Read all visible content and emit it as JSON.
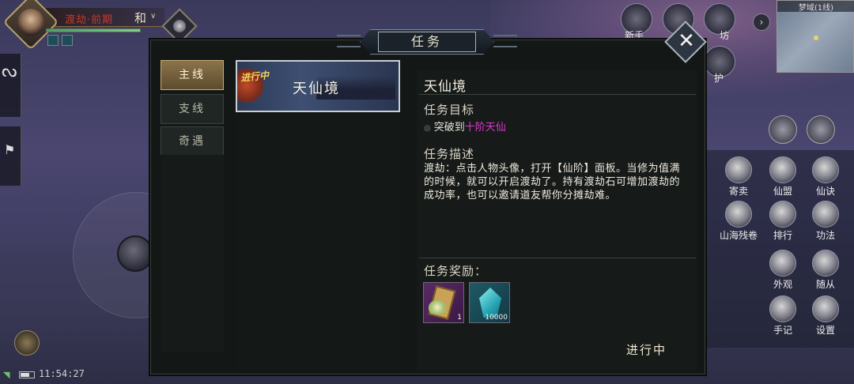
{
  "player": {
    "realm": "渡劫·前期",
    "extra": "和",
    "hp_fraction": 1.0
  },
  "top_right": {
    "icons": [
      {
        "label": "新手",
        "icon": "novice-icon"
      },
      {
        "label": "",
        "icon": "gift-icon"
      },
      {
        "label": "坊",
        "icon": "market-icon"
      },
      {
        "label": "护",
        "icon": "guard-icon"
      }
    ],
    "minimap_title": "梦域(1线)"
  },
  "window": {
    "title": "任务",
    "tabs": [
      "主线",
      "支线",
      "奇遇"
    ],
    "active_tab": 0
  },
  "quest_card": {
    "status_badge": "进行中",
    "title": "天仙境"
  },
  "detail": {
    "title": "天仙境",
    "objective_heading": "任务目标",
    "objective_prefix": "突破到",
    "objective_target": "十阶天仙",
    "description_heading": "任务描述",
    "description": "渡劫：点击人物头像，打开【仙阶】面板。当修为值满的时候，就可以开启渡劫了。持有渡劫石可增加渡劫的成功率，也可以邀请道友帮你分摊劫难。",
    "reward_heading": "任务奖励：",
    "rewards": [
      {
        "quantity": "1",
        "icon": "scroll-lotus-icon"
      },
      {
        "quantity": "10000",
        "icon": "crystal-icon"
      }
    ],
    "status": "进行中"
  },
  "right_menu": [
    {
      "label": "寄卖",
      "icon": "consign-icon"
    },
    {
      "label": "仙盟",
      "icon": "alliance-icon"
    },
    {
      "label": "仙诀",
      "icon": "skill-scroll-icon"
    },
    {
      "label": "山海残卷",
      "icon": "map-scroll-icon"
    },
    {
      "label": "排行",
      "icon": "ranking-icon"
    },
    {
      "label": "功法",
      "icon": "technique-icon"
    },
    {
      "label": "外观",
      "icon": "appearance-icon"
    },
    {
      "label": "随从",
      "icon": "follower-icon"
    },
    {
      "label": "手记",
      "icon": "notes-icon"
    },
    {
      "label": "设置",
      "icon": "settings-icon"
    }
  ],
  "status_bar": {
    "time": "11:54:27"
  },
  "colors": {
    "highlight": "#e03ad0",
    "badge": "#f2d35a",
    "window_bg": "#131716",
    "tab_active": "#8a744c"
  }
}
